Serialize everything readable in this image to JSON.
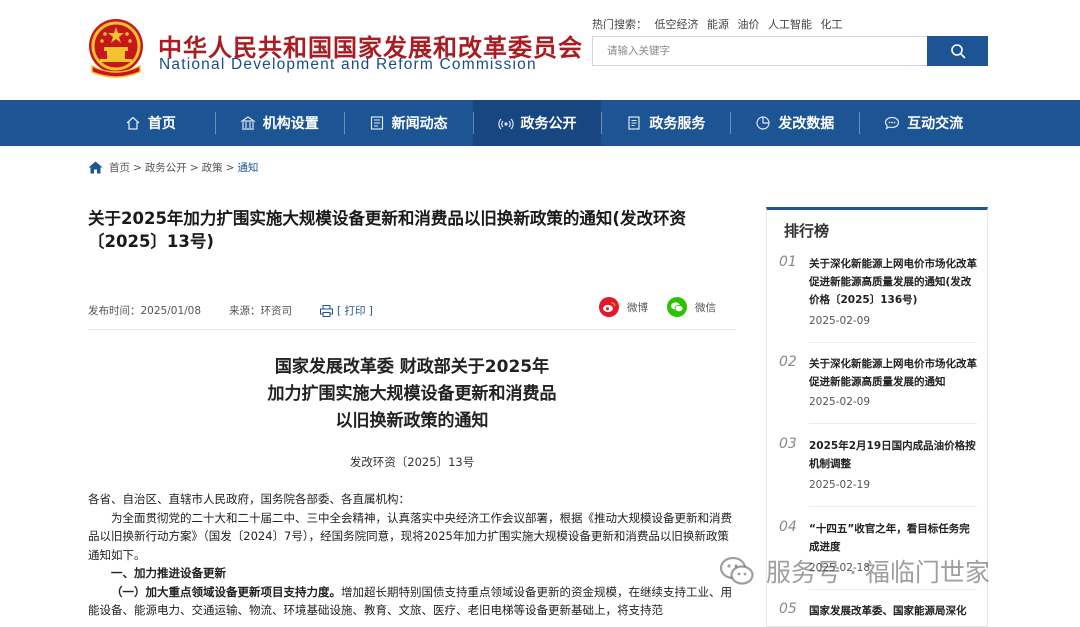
{
  "header": {
    "title_cn": "中华人民共和国国家发展和改革委员会",
    "title_en": "National Development and Reform Commission",
    "hot_search_label": "热门搜索：",
    "hot_search_items": [
      "低空经济",
      "能源",
      "油价",
      "人工智能",
      "化工"
    ],
    "search_placeholder": "请输入关键字",
    "brand_color": "#1d5493",
    "title_color": "#a91d22"
  },
  "nav": {
    "items": [
      {
        "label": "首页",
        "icon": "home-icon"
      },
      {
        "label": "机构设置",
        "icon": "building-icon"
      },
      {
        "label": "新闻动态",
        "icon": "news-icon"
      },
      {
        "label": "政务公开",
        "icon": "broadcast-icon"
      },
      {
        "label": "政务服务",
        "icon": "document-icon"
      },
      {
        "label": "发改数据",
        "icon": "pie-chart-icon"
      },
      {
        "label": "互动交流",
        "icon": "chat-icon"
      }
    ],
    "active_index": 3
  },
  "breadcrumb": {
    "items": [
      "首页",
      "政务公开",
      "政策",
      "通知"
    ],
    "separator": ">"
  },
  "article": {
    "title": "关于2025年加力扩围实施大规模设备更新和消费品以旧换新政策的通知(发改环资〔2025〕13号)",
    "publish_label": "发布时间：",
    "publish_date": "2025/01/08",
    "source_label": "来源：",
    "source": "环资司",
    "print_label": "[ 打印 ]",
    "share_weibo": "微博",
    "share_wechat": "微信",
    "doc_title_lines": [
      "国家发展改革委 财政部关于2025年",
      "加力扩围实施大规模设备更新和消费品",
      "以旧换新政策的通知"
    ],
    "doc_number": "发改环资〔2025〕13号",
    "salutation": "各省、自治区、直辖市人民政府，国务院各部委、各直属机构：",
    "intro": "为全面贯彻党的二十大和二十届二中、三中全会精神，认真落实中央经济工作会议部署，根据《推动大规模设备更新和消费品以旧换新行动方案》（国发〔2024〕7号），经国务院同意，现将2025年加力扩围实施大规模设备更新和消费品以旧换新政策通知如下。",
    "section1": "一、加力推进设备更新",
    "subsection1_heading": "（一）加大重点领域设备更新项目支持力度。",
    "subsection1_text": "增加超长期特别国债支持重点领域设备更新的资金规模，在继续支持工业、用能设备、能源电力、交通运输、物流、环境基础设施、教育、文旅、医疗、老旧电梯等设备更新基础上，将支持范"
  },
  "sidebar": {
    "title": "排行榜",
    "items": [
      {
        "num": "01",
        "text": "关于深化新能源上网电价市场化改革 促进新能源高质量发展的通知(发改价格〔2025〕136号)",
        "date": "2025-02-09"
      },
      {
        "num": "02",
        "text": "关于深化新能源上网电价市场化改革 促进新能源高质量发展的通知",
        "date": "2025-02-09"
      },
      {
        "num": "03",
        "text": "2025年2月19日国内成品油价格按机制调整",
        "date": "2025-02-19"
      },
      {
        "num": "04",
        "text": "“十四五”收官之年，看目标任务完成进度",
        "date": "2025-02-18"
      },
      {
        "num": "05",
        "text": "国家发展改革委、国家能源局深化",
        "date": ""
      }
    ]
  },
  "watermark": {
    "text": "服务号 · 福临门世家"
  }
}
